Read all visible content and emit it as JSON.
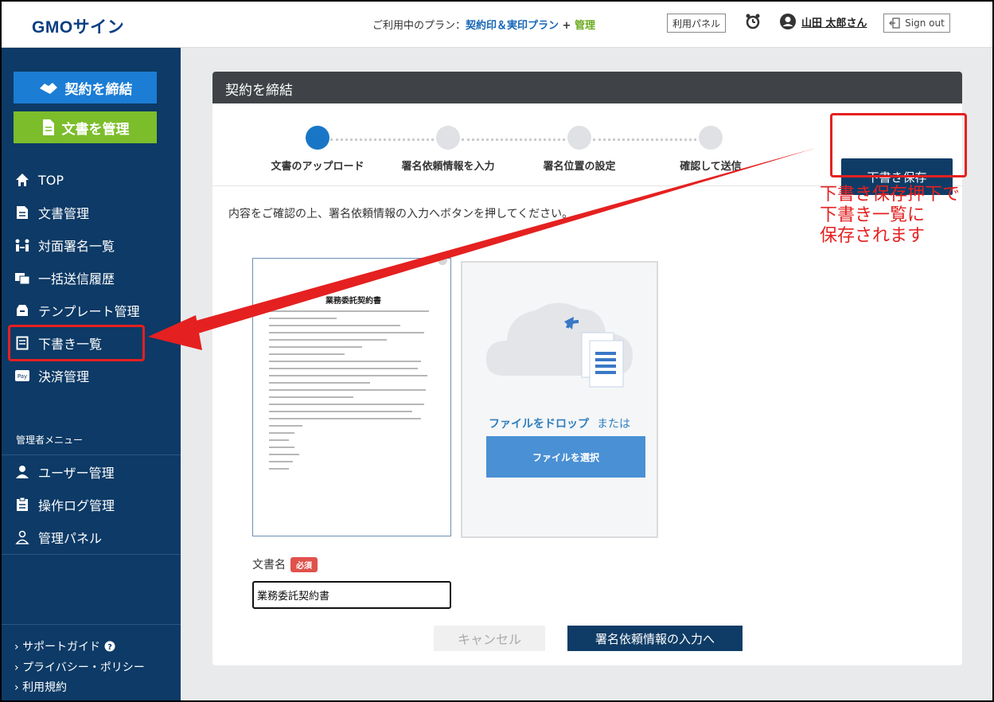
{
  "header": {
    "logo": "GMOサイン",
    "plan_prefix": "ご利用中のプラン：",
    "plan_name": "契約印＆実印プラン",
    "plan_plus": " + ",
    "plan_admin": "管理",
    "panel_button": "利用パネル",
    "user_name": "山田 太郎さん",
    "signout": "Sign out"
  },
  "sidebar": {
    "contract_button": "契約を締結",
    "manage_button": "文書を管理",
    "items": [
      {
        "label": "TOP",
        "icon": "home-icon"
      },
      {
        "label": "文書管理",
        "icon": "document-icon"
      },
      {
        "label": "対面署名一覧",
        "icon": "face-to-face-icon"
      },
      {
        "label": "一括送信履歴",
        "icon": "bulk-send-icon"
      },
      {
        "label": "テンプレート管理",
        "icon": "template-icon"
      },
      {
        "label": "下書き一覧",
        "icon": "draft-icon"
      },
      {
        "label": "決済管理",
        "icon": "payment-icon"
      }
    ],
    "admin_title": "管理者メニュー",
    "admin_items": [
      {
        "label": "ユーザー管理",
        "icon": "user-icon"
      },
      {
        "label": "操作ログ管理",
        "icon": "log-icon"
      },
      {
        "label": "管理パネル",
        "icon": "admin-panel-icon"
      }
    ],
    "footer": [
      "サポートガイド",
      "プライバシー・ポリシー",
      "利用規約"
    ]
  },
  "main": {
    "title": "契約を締結",
    "steps": [
      "文書のアップロード",
      "署名依頼情報を入力",
      "署名位置の設定",
      "確認して送信"
    ],
    "draft_button": "下書き保存",
    "instruction": "内容をご確認の上、署名依頼情報の入力へボタンを押してください。",
    "preview_title": "業務委託契約書",
    "drop_text": "ファイルをドロップ",
    "drop_or": "または",
    "select_button": "ファイルを選択",
    "doc_name_label": "文書名",
    "required_badge": "必須",
    "doc_name_value": "業務委託契約書",
    "cancel_button": "キャンセル",
    "next_button": "署名依頼情報の入力へ"
  },
  "annotation": {
    "lines": [
      "下書き保存押下で",
      "下書き一覧に",
      "保存されます"
    ],
    "color": "#e52020"
  },
  "colors": {
    "sidebar": "#0d3a66",
    "accent_blue": "#1b7dd4",
    "accent_green": "#7cbd2b",
    "primary_button": "#0f3c66"
  }
}
